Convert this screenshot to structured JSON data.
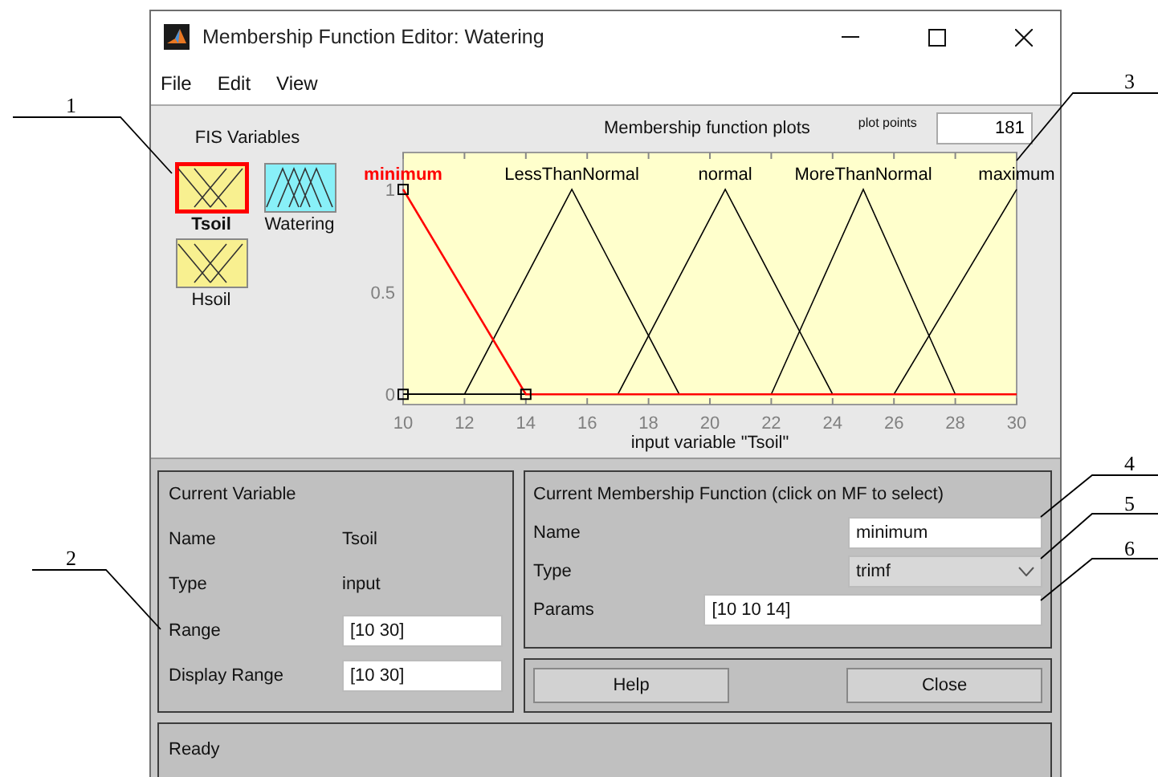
{
  "window": {
    "title": "Membership Function Editor: Watering"
  },
  "menu": [
    {
      "label": "File"
    },
    {
      "label": "Edit"
    },
    {
      "label": "View"
    }
  ],
  "fis_variables": {
    "title": "FIS Variables",
    "items": [
      {
        "name": "Tsoil",
        "kind": "input",
        "selected": true
      },
      {
        "name": "Watering",
        "kind": "output",
        "selected": false
      },
      {
        "name": "Hsoil",
        "kind": "input",
        "selected": false
      }
    ]
  },
  "plot": {
    "plot_points_label": "plot points",
    "plot_points": "181",
    "curves": [
      {
        "selected": true
      },
      {
        "selected": false
      },
      {
        "selected": false
      },
      {
        "selected": false
      },
      {
        "selected": false
      }
    ],
    "chart_data": {
      "type": "line",
      "title": "Membership function plots",
      "xlabel": "input variable \"Tsoil\"",
      "x": [
        10,
        12,
        14,
        15.5,
        17,
        19,
        20.5,
        22,
        24,
        25,
        26,
        28,
        30
      ],
      "xlim": [
        10,
        30
      ],
      "ylim": [
        -0.05,
        1.18
      ],
      "xticks": [
        10,
        12,
        14,
        16,
        18,
        20,
        22,
        24,
        26,
        28,
        30
      ],
      "yticks": [
        0,
        0.5,
        1
      ],
      "series": [
        {
          "name": "minimum",
          "color": "#ff0000",
          "values": [
            1,
            0.5,
            0,
            0,
            0,
            0,
            0,
            0,
            0,
            0,
            0,
            0,
            0
          ]
        },
        {
          "name": "LessThanNormal",
          "color": "#000000",
          "values": [
            0,
            0,
            0.571,
            1,
            0.571,
            0,
            0,
            0,
            0,
            0,
            0,
            0,
            0
          ]
        },
        {
          "name": "normal",
          "color": "#000000",
          "values": [
            0,
            0,
            0,
            0,
            0,
            0.571,
            1,
            0.571,
            0,
            0,
            0,
            0,
            0
          ]
        },
        {
          "name": "MoreThanNormal",
          "color": "#000000",
          "values": [
            0,
            0,
            0,
            0,
            0,
            0,
            0,
            0,
            0.667,
            1,
            0.667,
            0,
            0
          ]
        },
        {
          "name": "maximum",
          "color": "#000000",
          "values": [
            0,
            0,
            0,
            0,
            0,
            0,
            0,
            0,
            0,
            0,
            0,
            0.5,
            1
          ]
        }
      ]
    }
  },
  "current_variable": {
    "title": "Current Variable",
    "rows": [
      {
        "label": "Name",
        "value": "Tsoil",
        "kind": "text"
      },
      {
        "label": "Type",
        "value": "input",
        "kind": "text"
      },
      {
        "label": "Range",
        "value": "[10 30]",
        "kind": "field"
      },
      {
        "label": "Display Range",
        "value": "[10 30]",
        "kind": "field"
      }
    ]
  },
  "current_mf": {
    "title": "Current Membership Function (click on MF to select)",
    "name": {
      "label": "Name",
      "value": "minimum"
    },
    "type": {
      "label": "Type",
      "value": "trimf"
    },
    "params": {
      "label": "Params",
      "value": "[10 10 14]"
    }
  },
  "buttons": [
    {
      "label": "Help"
    },
    {
      "label": "Close"
    }
  ],
  "status": "Ready",
  "callouts": [
    "1",
    "2",
    "3",
    "4",
    "5",
    "6"
  ]
}
